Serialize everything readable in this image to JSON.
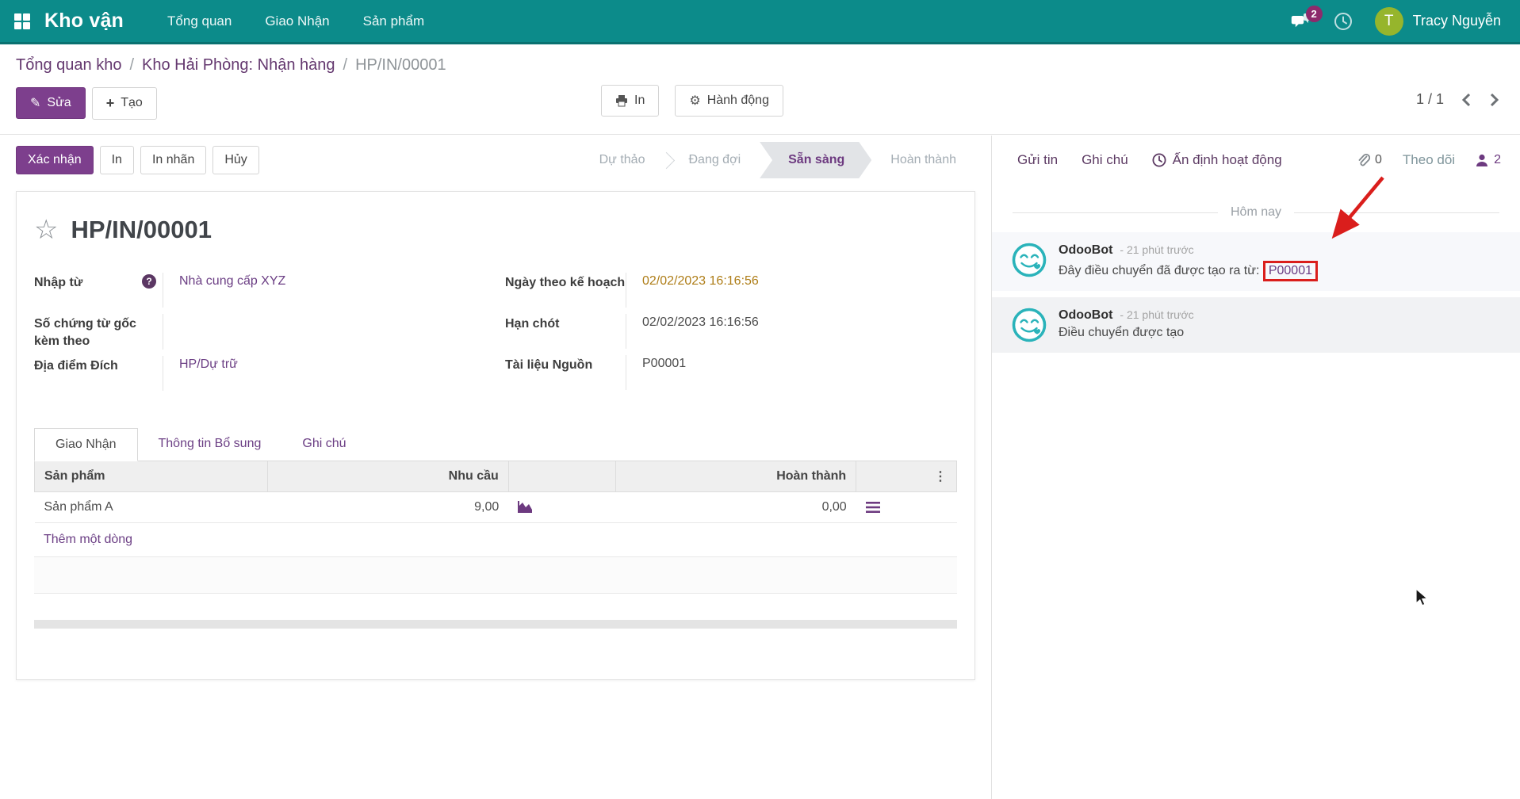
{
  "colors": {
    "navbar_bg": "#0c8b8a",
    "primary_purple": "#7d3f8d",
    "link_purple": "#6b3e84",
    "badge_purple": "#8d2a6c",
    "avatar_green": "#96b52c",
    "date_gold": "#ae7d17",
    "annotation_red": "#da1e1c",
    "odoobot_teal": "#2ab3ba"
  },
  "navbar": {
    "brand": "Kho vận",
    "items": [
      {
        "label": "Tổng quan"
      },
      {
        "label": "Giao Nhận"
      },
      {
        "label": "Sản phẩm"
      }
    ],
    "messages_badge": "2",
    "user": {
      "initial": "T",
      "name": "Tracy Nguyễn"
    }
  },
  "breadcrumb": {
    "part1": "Tổng quan kho",
    "part2": "Kho Hải Phòng: Nhận hàng",
    "part3": "HP/IN/00001",
    "separator": "/"
  },
  "control": {
    "edit": "Sửa",
    "create": "Tạo",
    "print": "In",
    "action": "Hành động",
    "pager": "1 / 1"
  },
  "statusbar": {
    "confirm": "Xác nhận",
    "print": "In",
    "print_label": "In nhãn",
    "cancel": "Hủy",
    "stages": [
      {
        "label": "Dự thảo"
      },
      {
        "label": "Đang đợi"
      },
      {
        "label": "Sẵn sàng"
      },
      {
        "label": "Hoàn thành"
      }
    ],
    "active_stage": "Sẵn sàng"
  },
  "sheet": {
    "title": "HP/IN/00001",
    "fields": {
      "receive_from_label": "Nhập từ",
      "receive_from_value": "Nhà cung cấp XYZ",
      "source_doc_label": "Số chứng từ gốc kèm theo",
      "source_doc_value": "",
      "dest_label": "Địa điểm Đích",
      "dest_value": "HP/Dự trữ",
      "scheduled_label": "Ngày theo kế hoạch",
      "scheduled_value": "02/02/2023 16:16:56",
      "deadline_label": "Hạn chót",
      "deadline_value": "02/02/2023 16:16:56",
      "source_label": "Tài liệu Nguồn",
      "source_value": "P00001"
    },
    "tabs": [
      {
        "label": "Giao Nhận"
      },
      {
        "label": "Thông tin Bổ sung"
      },
      {
        "label": "Ghi chú"
      }
    ],
    "active_tab": "Giao Nhận",
    "table": {
      "col_product": "Sản phẩm",
      "col_demand": "Nhu cầu",
      "col_done": "Hoàn thành",
      "rows": [
        {
          "product": "Sản phẩm A",
          "demand": "9,00",
          "done": "0,00"
        }
      ],
      "add_line": "Thêm một dòng"
    }
  },
  "chatter": {
    "send": "Gửi tin",
    "log": "Ghi chú",
    "activity": "Ấn định hoạt động",
    "attachments": "0",
    "follow": "Theo dõi",
    "followers": "2",
    "divider": "Hôm nay",
    "messages": [
      {
        "author": "OdooBot",
        "time": "- 21 phút trước",
        "prefix": "Đây điều chuyển đã được tạo ra từ: ",
        "link": "P00001",
        "body": ""
      },
      {
        "author": "OdooBot",
        "time": "- 21 phút trước",
        "prefix": "",
        "link": "",
        "body": "Điều chuyển được tạo"
      }
    ]
  },
  "glyphs": {
    "gear": "⚙",
    "star": "☆",
    "dots": "⋮",
    "pencil": "✎",
    "plus": "+",
    "help": "?"
  }
}
